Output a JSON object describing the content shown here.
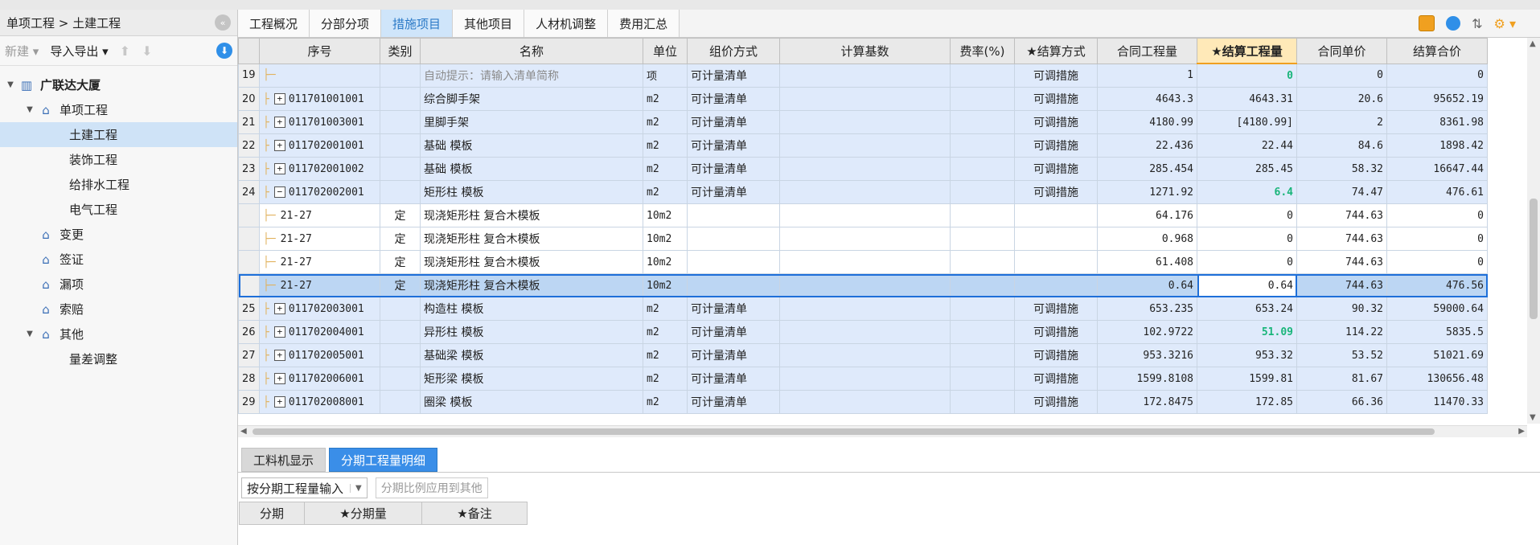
{
  "sidebar": {
    "breadcrumb": "单项工程 > 土建工程",
    "toolbar": {
      "new_label": "新建",
      "io_label": "导入导出"
    },
    "tree": [
      {
        "label": "广联达大厦",
        "level": 0,
        "caret": true,
        "icon": "building-icon",
        "bold": true
      },
      {
        "label": "单项工程",
        "level": 1,
        "caret": true,
        "icon": "house-icon"
      },
      {
        "label": "土建工程",
        "level": 2,
        "selected": true
      },
      {
        "label": "装饰工程",
        "level": 2
      },
      {
        "label": "给排水工程",
        "level": 2
      },
      {
        "label": "电气工程",
        "level": 2
      },
      {
        "label": "变更",
        "level": 1,
        "icon": "house-icon"
      },
      {
        "label": "签证",
        "level": 1,
        "icon": "house-icon"
      },
      {
        "label": "漏项",
        "level": 1,
        "icon": "house-icon"
      },
      {
        "label": "索赔",
        "level": 1,
        "icon": "house-icon"
      },
      {
        "label": "其他",
        "level": 1,
        "caret": true,
        "icon": "house-icon"
      },
      {
        "label": "量差调整",
        "level": 2
      }
    ]
  },
  "tabs": [
    "工程概况",
    "分部分项",
    "措施项目",
    "其他项目",
    "人材机调整",
    "费用汇总"
  ],
  "active_tab": "措施项目",
  "grid": {
    "headers": [
      "序号",
      "类别",
      "名称",
      "单位",
      "组价方式",
      "计算基数",
      "费率(%)",
      "★结算方式",
      "合同工程量",
      "★结算工程量",
      "合同单价",
      "结算合价"
    ],
    "rows": [
      {
        "idx": "19",
        "code": "",
        "cat": "",
        "name": "自动提示：请输入清单简称",
        "unit": "项",
        "method": "可计量清单",
        "base": "",
        "rate": "",
        "settle": "可调措施",
        "qty": "1",
        "sqty": "0",
        "price": "0",
        "total": "0",
        "style": "blue",
        "name_grey": true,
        "sqty_green": true,
        "tree": "line"
      },
      {
        "idx": "20",
        "code": "011701001001",
        "cat": "",
        "name": "综合脚手架",
        "unit": "m2",
        "method": "可计量清单",
        "base": "",
        "rate": "",
        "settle": "可调措施",
        "qty": "4643.3",
        "sqty": "4643.31",
        "price": "20.6",
        "total": "95652.19",
        "style": "blue",
        "tree": "plus"
      },
      {
        "idx": "21",
        "code": "011701003001",
        "cat": "",
        "name": "里脚手架",
        "unit": "m2",
        "method": "可计量清单",
        "base": "",
        "rate": "",
        "settle": "可调措施",
        "qty": "4180.99",
        "sqty": "[4180.99]",
        "price": "2",
        "total": "8361.98",
        "style": "blue",
        "tree": "plus"
      },
      {
        "idx": "22",
        "code": "011702001001",
        "cat": "",
        "name": "基础 模板",
        "unit": "m2",
        "method": "可计量清单",
        "base": "",
        "rate": "",
        "settle": "可调措施",
        "qty": "22.436",
        "sqty": "22.44",
        "price": "84.6",
        "total": "1898.42",
        "style": "blue",
        "tree": "plus"
      },
      {
        "idx": "23",
        "code": "011702001002",
        "cat": "",
        "name": "基础 模板",
        "unit": "m2",
        "method": "可计量清单",
        "base": "",
        "rate": "",
        "settle": "可调措施",
        "qty": "285.454",
        "sqty": "285.45",
        "price": "58.32",
        "total": "16647.44",
        "style": "blue",
        "tree": "plus"
      },
      {
        "idx": "24",
        "code": "011702002001",
        "cat": "",
        "name": "矩形柱 模板",
        "unit": "m2",
        "method": "可计量清单",
        "base": "",
        "rate": "",
        "settle": "可调措施",
        "qty": "1271.92",
        "sqty": "6.4",
        "price": "74.47",
        "total": "476.61",
        "style": "blue",
        "sqty_green": true,
        "tree": "minus"
      },
      {
        "idx": "",
        "code": "21-27",
        "cat": "定",
        "name": "现浇矩形柱 复合木模板",
        "unit": "10m2",
        "method": "",
        "base": "",
        "rate": "",
        "settle": "",
        "qty": "64.176",
        "sqty": "0",
        "price": "744.63",
        "total": "0",
        "style": "white",
        "tree": "child"
      },
      {
        "idx": "",
        "code": "21-27",
        "cat": "定",
        "name": "现浇矩形柱 复合木模板",
        "unit": "10m2",
        "method": "",
        "base": "",
        "rate": "",
        "settle": "",
        "qty": "0.968",
        "sqty": "0",
        "price": "744.63",
        "total": "0",
        "style": "white",
        "tree": "child"
      },
      {
        "idx": "",
        "code": "21-27",
        "cat": "定",
        "name": "现浇矩形柱 复合木模板",
        "unit": "10m2",
        "method": "",
        "base": "",
        "rate": "",
        "settle": "",
        "qty": "61.408",
        "sqty": "0",
        "price": "744.63",
        "total": "0",
        "style": "white",
        "tree": "child"
      },
      {
        "idx": "",
        "code": "21-27",
        "cat": "定",
        "name": "现浇矩形柱 复合木模板",
        "unit": "10m2",
        "method": "",
        "base": "",
        "rate": "",
        "settle": "",
        "qty": "0.64",
        "sqty": "0.64",
        "price": "744.63",
        "total": "476.56",
        "style": "sel",
        "tree": "child",
        "editing": true
      },
      {
        "idx": "25",
        "code": "011702003001",
        "cat": "",
        "name": "构造柱 模板",
        "unit": "m2",
        "method": "可计量清单",
        "base": "",
        "rate": "",
        "settle": "可调措施",
        "qty": "653.235",
        "sqty": "653.24",
        "price": "90.32",
        "total": "59000.64",
        "style": "blue",
        "tree": "plus"
      },
      {
        "idx": "26",
        "code": "011702004001",
        "cat": "",
        "name": "异形柱 模板",
        "unit": "m2",
        "method": "可计量清单",
        "base": "",
        "rate": "",
        "settle": "可调措施",
        "qty": "102.9722",
        "sqty": "51.09",
        "price": "114.22",
        "total": "5835.5",
        "style": "blue",
        "sqty_green": true,
        "tree": "plus"
      },
      {
        "idx": "27",
        "code": "011702005001",
        "cat": "",
        "name": "基础梁 模板",
        "unit": "m2",
        "method": "可计量清单",
        "base": "",
        "rate": "",
        "settle": "可调措施",
        "qty": "953.3216",
        "sqty": "953.32",
        "price": "53.52",
        "total": "51021.69",
        "style": "blue",
        "tree": "plus"
      },
      {
        "idx": "28",
        "code": "011702006001",
        "cat": "",
        "name": "矩形梁 模板",
        "unit": "m2",
        "method": "可计量清单",
        "base": "",
        "rate": "",
        "settle": "可调措施",
        "qty": "1599.8108",
        "sqty": "1599.81",
        "price": "81.67",
        "total": "130656.48",
        "style": "blue",
        "tree": "plus"
      },
      {
        "idx": "29",
        "code": "011702008001",
        "cat": "",
        "name": "圈梁 模板",
        "unit": "m2",
        "method": "可计量清单",
        "base": "",
        "rate": "",
        "settle": "可调措施",
        "qty": "172.8475",
        "sqty": "172.85",
        "price": "66.36",
        "total": "11470.33",
        "style": "blue",
        "tree": "plus"
      }
    ]
  },
  "bottom": {
    "tabs": [
      "工料机显示",
      "分期工程量明细"
    ],
    "active_tab": "分期工程量明细",
    "mode_select": "按分期工程量输入",
    "apply_button": "分期比例应用到其他",
    "headers": [
      "分期",
      "★分期量",
      "★备注"
    ]
  },
  "colors": {
    "accent": "#2f8fe8",
    "highlight_header": "#ffe9b8",
    "green_value": "#19b57a",
    "row_blue": "#dfeafb"
  }
}
